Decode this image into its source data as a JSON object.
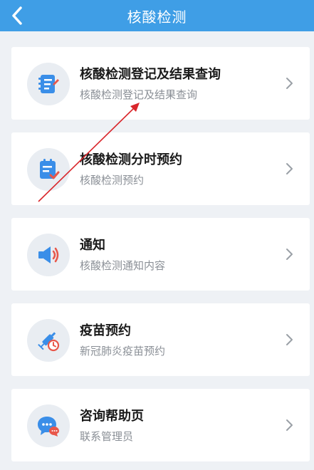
{
  "header": {
    "title": "核酸检测",
    "back_icon": "chevron-left-icon"
  },
  "colors": {
    "header_bg": "#3f9ee6",
    "icon_blue": "#3a8ee8",
    "icon_red": "#e8574a",
    "page_bg": "#eef1f5",
    "annotation_arrow": "#d9262b"
  },
  "items": [
    {
      "title": "核酸检测登记及结果查询",
      "subtitle": "核酸检测登记及结果查询",
      "icon": "notebook-pen-icon"
    },
    {
      "title": "核酸检测分时预约",
      "subtitle": "核酸检测预约",
      "icon": "clipboard-check-icon"
    },
    {
      "title": "通知",
      "subtitle": "核酸检测通知内容",
      "icon": "speaker-icon"
    },
    {
      "title": "疫苗预约",
      "subtitle": "新冠肺炎疫苗预约",
      "icon": "syringe-clock-icon"
    },
    {
      "title": "咨询帮助页",
      "subtitle": "联系管理员",
      "icon": "chat-bubbles-icon"
    }
  ]
}
